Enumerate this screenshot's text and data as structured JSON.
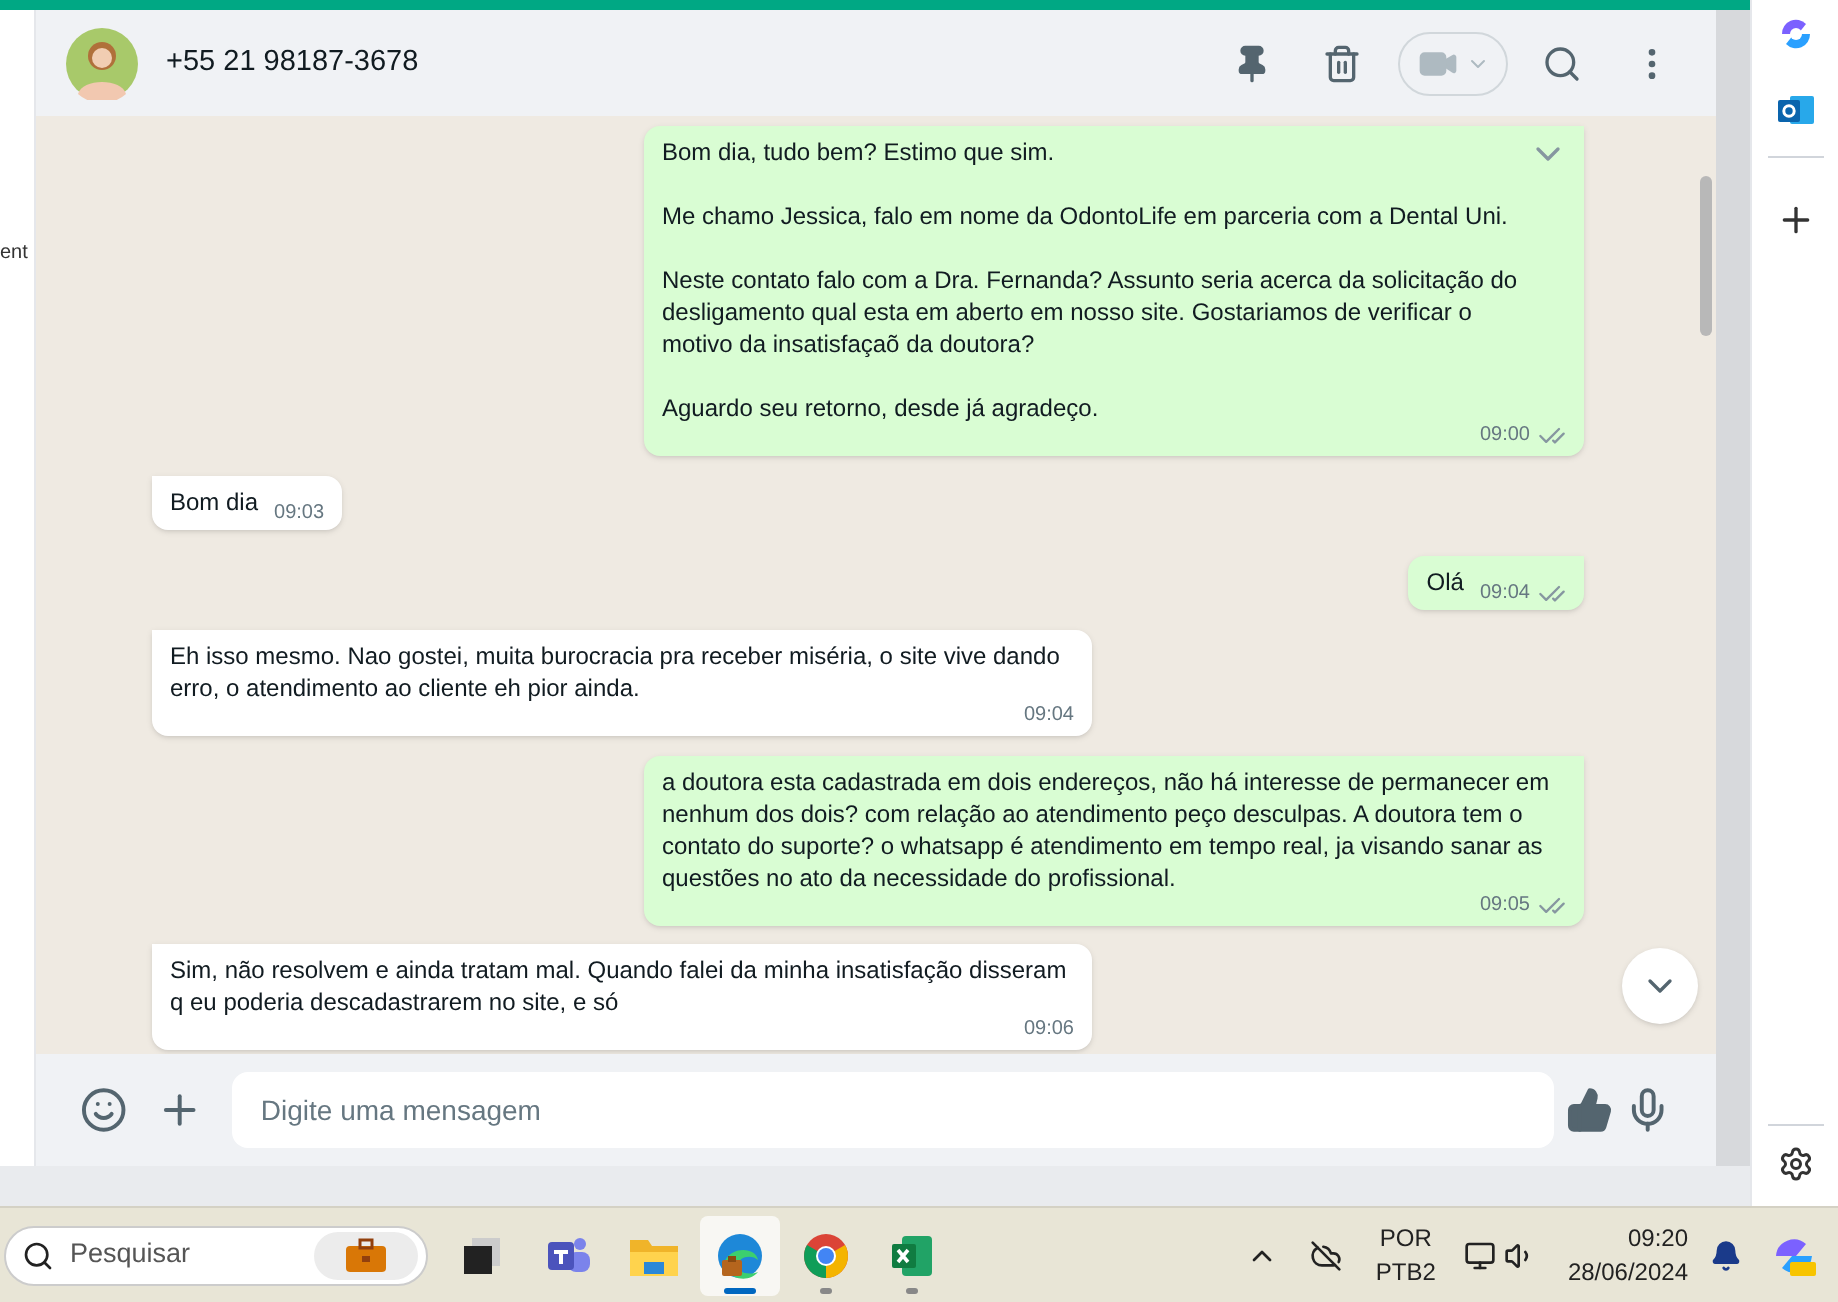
{
  "sidebar": {
    "cut_label": "ent"
  },
  "chat": {
    "contact": "+55 21 98187-3678",
    "messages": [
      {
        "kind": "outgoing",
        "text": "Bom dia, tudo bem? Estimo que sim.\n\nMe chamo Jessica, falo em nome da OdontoLife em parceria com a Dental Uni.\n\nNeste contato falo com a Dra. Fernanda? Assunto seria acerca da solicitação do desligamento qual esta em aberto em nosso site. Gostariamos de verificar o motivo da insatisfaçaõ da doutora?\n\nAguardo seu retorno, desde já agradeço.",
        "time": "09:00",
        "read": true
      },
      {
        "kind": "incoming",
        "text": "Bom dia",
        "time": "09:03"
      },
      {
        "kind": "outgoing",
        "text": "Olá",
        "time": "09:04",
        "read": true
      },
      {
        "kind": "incoming",
        "text": "Eh isso mesmo. Nao gostei, muita burocracia pra receber miséria, o site vive dando erro, o atendimento ao cliente eh pior ainda.",
        "time": "09:04"
      },
      {
        "kind": "outgoing",
        "text": "a doutora esta cadastrada em dois endereços, não há interesse de permanecer em nenhum dos dois? com relação ao atendimento peço desculpas. A doutora tem o contato do suporte? o whatsapp é atendimento em tempo real, ja visando sanar as questões no ato da necessidade do profissional.",
        "time": "09:05",
        "read": true
      },
      {
        "kind": "incoming",
        "text": "Sim, não resolvem e ainda tratam mal. Quando falei da minha insatisfação disseram q eu poderia descadastrarem no site, e só",
        "time": "09:06"
      }
    ],
    "composer": {
      "placeholder": "Digite uma mensagem"
    }
  },
  "taskbar": {
    "search": {
      "placeholder": "Pesquisar"
    },
    "apps": [
      {
        "kind": "taskview",
        "selected": false,
        "running": false
      },
      {
        "kind": "teams",
        "selected": false,
        "running": false
      },
      {
        "kind": "files",
        "selected": false,
        "running": false
      },
      {
        "kind": "edge",
        "selected": true,
        "running": true
      },
      {
        "kind": "chrome",
        "selected": false,
        "running": true
      },
      {
        "kind": "excel",
        "selected": false,
        "running": true
      }
    ],
    "language": "POR",
    "layout": "PTB2",
    "time": "09:20",
    "date": "28/06/2024"
  }
}
